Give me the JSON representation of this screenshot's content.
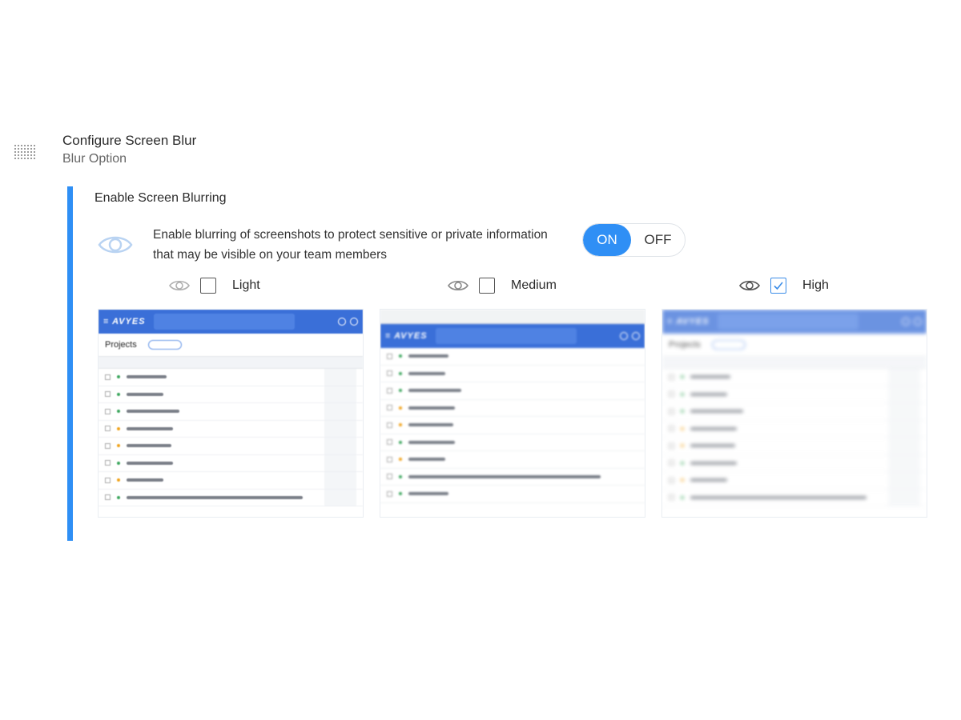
{
  "header": {
    "title": "Configure Screen Blur",
    "subtitle": "Blur Option"
  },
  "section": {
    "title": "Enable Screen Blurring",
    "description": "Enable blurring of screenshots to protect sensitive or private information that may be visible on your team members"
  },
  "toggle": {
    "on_label": "ON",
    "off_label": "OFF",
    "state": "ON"
  },
  "options": [
    {
      "label": "Light",
      "checked": false
    },
    {
      "label": "Medium",
      "checked": false
    },
    {
      "label": "High",
      "checked": true
    }
  ],
  "previews": {
    "page_title": "Projects"
  },
  "colors": {
    "accent": "#2f8ff5",
    "preview_topbar": "#3a6fd8"
  }
}
